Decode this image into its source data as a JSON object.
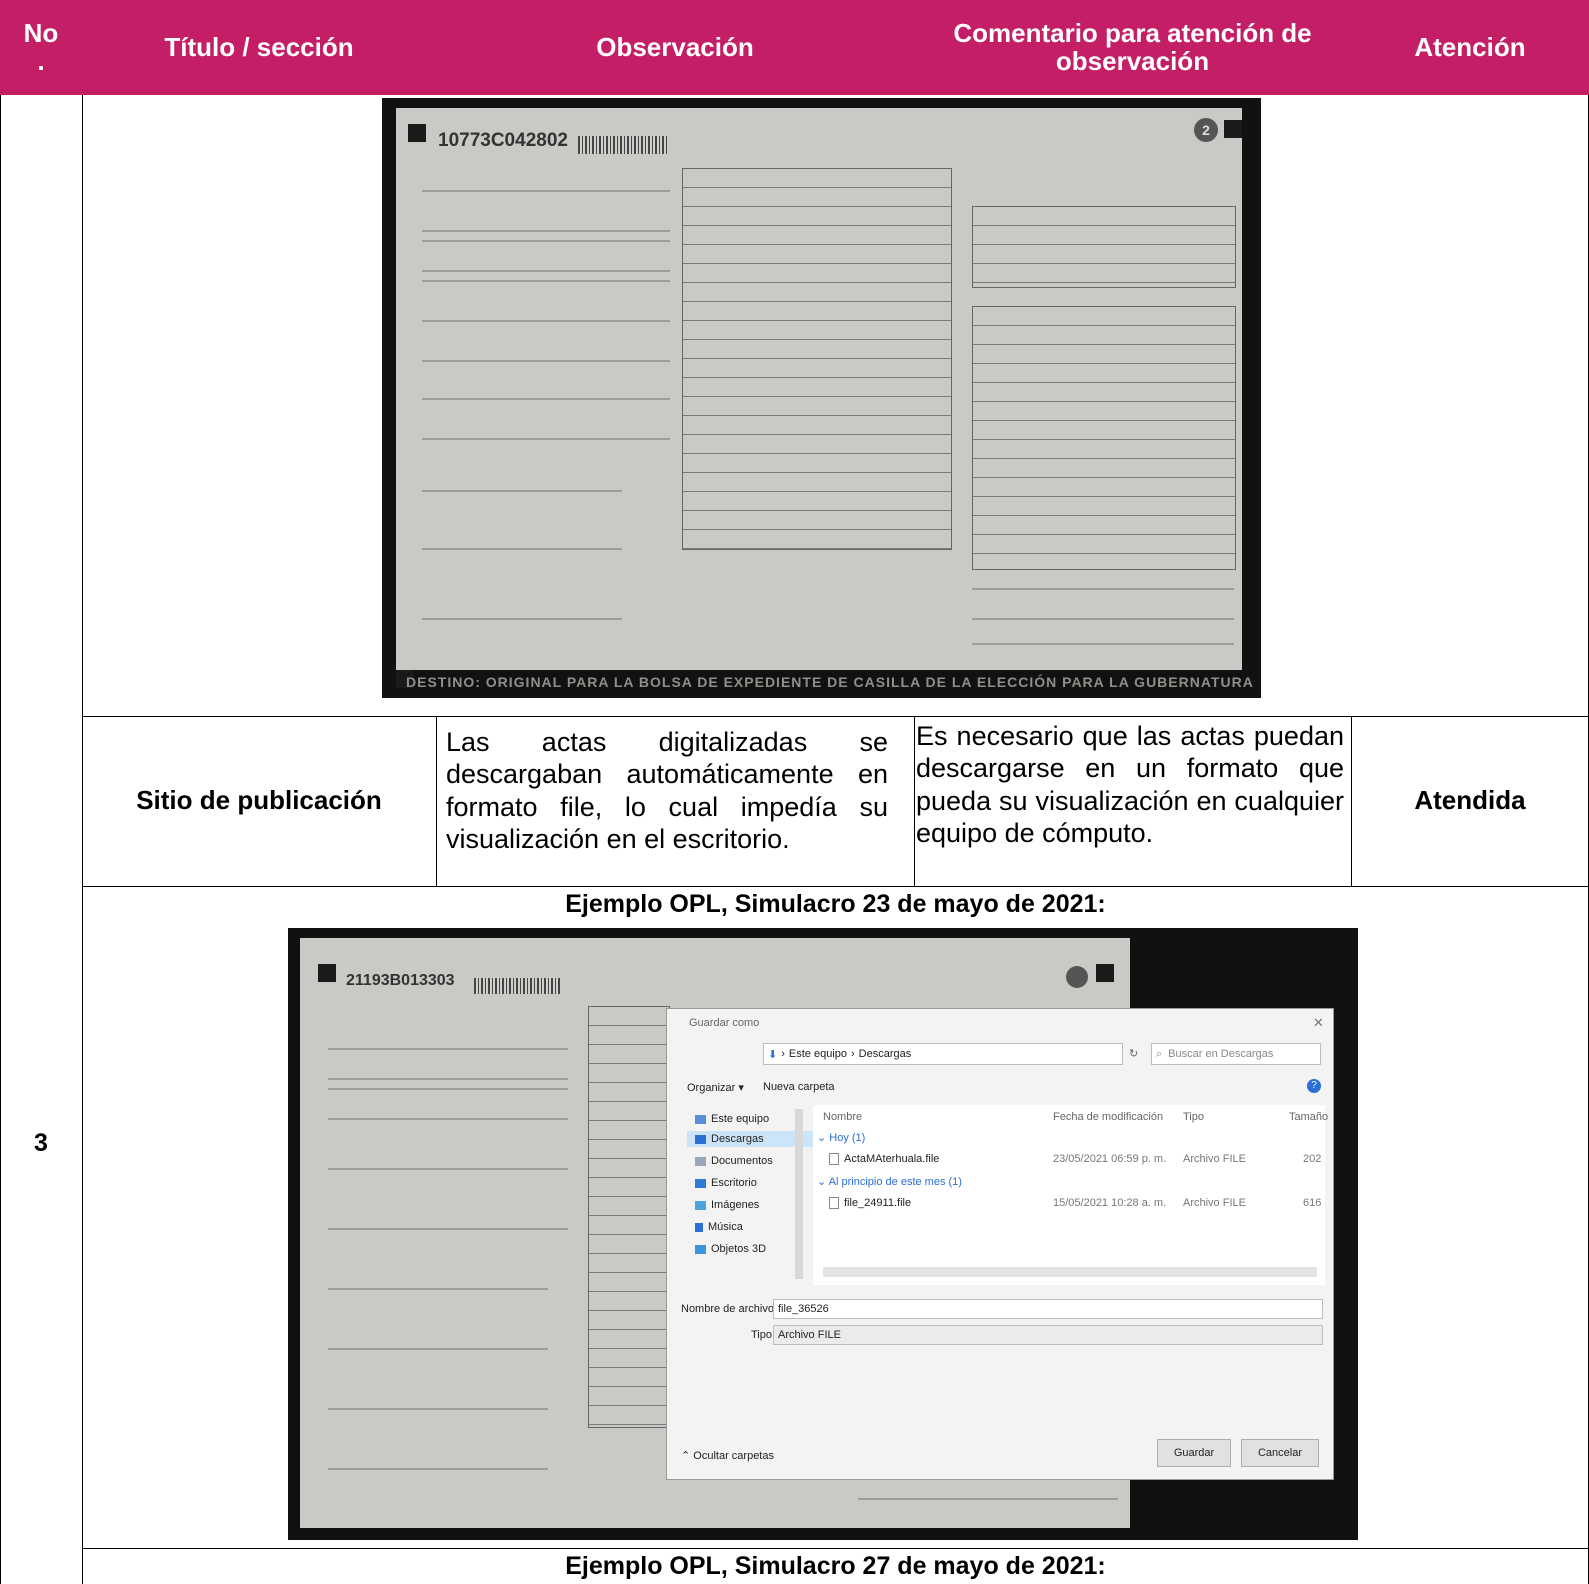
{
  "header": {
    "col_no": "No\n.",
    "col_title": "Título / sección",
    "col_obs": "Observación",
    "col_comment": "Comentario para atención de observación",
    "col_attention": "Atención"
  },
  "row": {
    "number": "3",
    "title": "Sitio de publicación",
    "observation": "Las actas digitalizadas se descargaban automáticamente en formato file, lo cual impedía su visualización en el escritorio.",
    "comment": "Es necesario que las actas puedan descargarse en un formato que pueda su visualización en cualquier equipo de cómputo.",
    "attention": "Atendida"
  },
  "photo1": {
    "doc_id": "10773C042802",
    "page_number": "2",
    "footer": "DESTINO: ORIGINAL PARA LA BOLSA DE EXPEDIENTE DE CASILLA DE LA ELECCIÓN PARA LA GUBERNATURA"
  },
  "caption1": "Ejemplo OPL, Simulacro 23 de mayo de 2021:",
  "photo2": {
    "doc_id": "21193B013303",
    "dialog": {
      "title": "Guardar como",
      "path_this_pc": "Este equipo",
      "path_downloads": "Descargas",
      "search_placeholder": "Buscar en Descargas",
      "organize": "Organizar ▾",
      "new_folder": "Nueva carpeta",
      "nav_items": [
        "Este equipo",
        "Descargas",
        "Documentos",
        "Escritorio",
        "Imágenes",
        "Música",
        "Objetos 3D"
      ],
      "columns": [
        "Nombre",
        "Fecha de modificación",
        "Tipo",
        "Tamaño"
      ],
      "group_today": "Hoy (1)",
      "group_month": "Al principio de este mes (1)",
      "files": [
        {
          "name": "ActaMAterhuala.file",
          "date": "23/05/2021 06:59 p. m.",
          "type": "Archivo FILE",
          "size": "202"
        },
        {
          "name": "file_24911.file",
          "date": "15/05/2021 10:28 a. m.",
          "type": "Archivo FILE",
          "size": "616"
        }
      ],
      "filename_label": "Nombre de archivo:",
      "filename_value": "file_36526",
      "type_label": "Tipo:",
      "type_value": "Archivo FILE",
      "hide_folders": "Ocultar carpetas",
      "save": "Guardar",
      "cancel": "Cancelar"
    }
  },
  "caption2": "Ejemplo OPL, Simulacro 27 de mayo de 2021:"
}
